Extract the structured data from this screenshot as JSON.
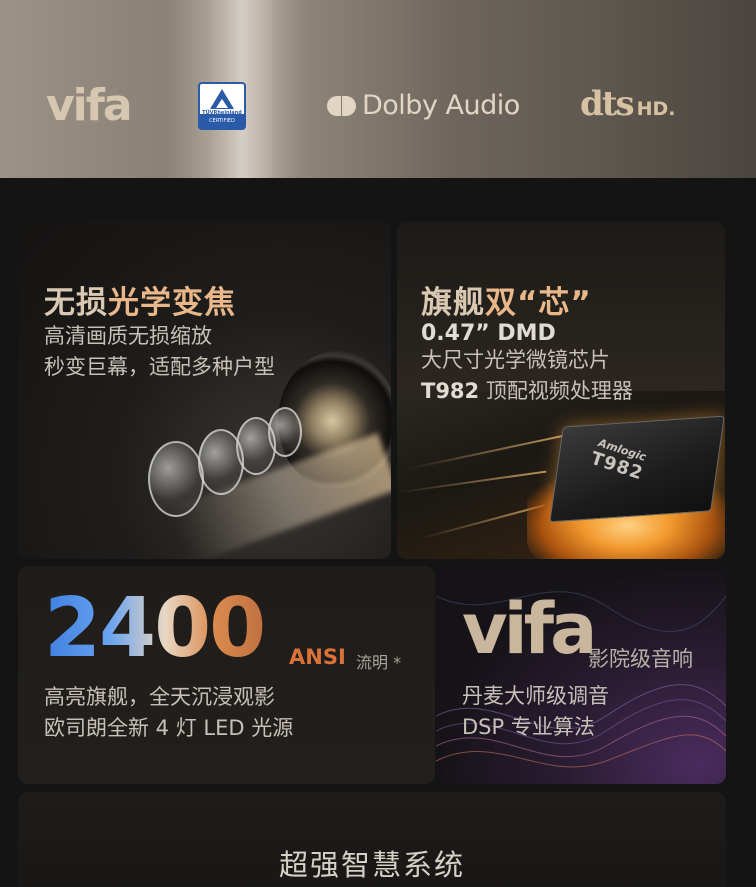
{
  "logos": {
    "vifa": "vifa",
    "tuv_name": "TÜVRheinland",
    "tuv_badge": "CERTIFIED",
    "dolby": "Dolby Audio",
    "dts": "dts",
    "dts_hd": "HD."
  },
  "zoom_card": {
    "title_plain": "无损",
    "title_highlight": "光学变焦",
    "lines": [
      "高清画质无损缩放",
      "秒变巨幕，适配多种户型"
    ]
  },
  "chip_card": {
    "title_plain": "旗舰",
    "title_highlight": "双“芯”",
    "spec": "0.47” DMD",
    "lines": [
      "大尺寸光学微镜芯片"
    ],
    "processor_model": "T982",
    "processor_text": "顶配视频处理器",
    "chip_brand": "Amlogic",
    "chip_model": "T982"
  },
  "brightness_card": {
    "value": "2400",
    "unit": "ANSI",
    "unit_note": "流明 *",
    "lines": [
      "高亮旗舰，全天沉浸观影",
      "欧司朗全新 4 灯 LED 光源"
    ]
  },
  "audio_card": {
    "brand": "vifa",
    "tag": "影院级音响",
    "lines": [
      "丹麦大师级调音",
      "DSP 专业算法"
    ]
  },
  "system_card": {
    "title": "超强智慧系统"
  },
  "colors": {
    "accent_orange": "#d9733a",
    "title_gold": "#d9c9b2",
    "gradient_blue": "#3e7fe0"
  }
}
